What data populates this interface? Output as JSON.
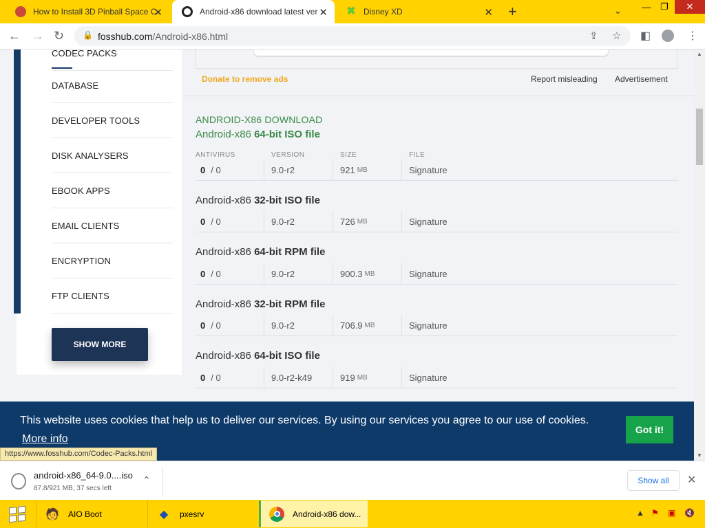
{
  "browser": {
    "tabs": [
      {
        "title": "How to Install 3D Pinball Space C",
        "icon": "pinball-favicon"
      },
      {
        "title": "Android-x86 download latest ver",
        "icon": "fosshub-favicon",
        "active": true
      },
      {
        "title": "Disney XD",
        "icon": "disney-favicon"
      }
    ],
    "url_host": "fosshub.com",
    "url_path": "/Android-x86.html"
  },
  "sidebar": {
    "items": [
      {
        "label": "CODEC PACKS"
      },
      {
        "label": "DATABASE"
      },
      {
        "label": "DEVELOPER TOOLS"
      },
      {
        "label": "DISK ANALYSERS"
      },
      {
        "label": "EBOOK APPS"
      },
      {
        "label": "EMAIL CLIENTS"
      },
      {
        "label": "ENCRYPTION"
      },
      {
        "label": "FTP CLIENTS"
      }
    ],
    "show_more": "SHOW MORE"
  },
  "ad": {
    "donate": "Donate to remove ads",
    "report": "Report misleading",
    "label": "Advertisement"
  },
  "downloads": {
    "header": "ANDROID-X86 DOWNLOAD",
    "columns": [
      "ANTIVIRUS",
      "VERSION",
      "SIZE",
      "FILE"
    ],
    "files": [
      {
        "name": "Android-x86",
        "bold": "64-bit ISO file",
        "av_pos": "0",
        "av_total": "/ 0",
        "version": "9.0-r2",
        "size": "921",
        "unit": "MB",
        "file": "Signature"
      },
      {
        "name": "Android-x86",
        "bold": "32-bit ISO file",
        "av_pos": "0",
        "av_total": "/ 0",
        "version": "9.0-r2",
        "size": "726",
        "unit": "MB",
        "file": "Signature"
      },
      {
        "name": "Android-x86",
        "bold": "64-bit RPM file",
        "av_pos": "0",
        "av_total": "/ 0",
        "version": "9.0-r2",
        "size": "900.3",
        "unit": "MB",
        "file": "Signature"
      },
      {
        "name": "Android-x86",
        "bold": "32-bit RPM file",
        "av_pos": "0",
        "av_total": "/ 0",
        "version": "9.0-r2",
        "size": "706.9",
        "unit": "MB",
        "file": "Signature"
      },
      {
        "name": "Android-x86",
        "bold": "64-bit ISO file",
        "av_pos": "0",
        "av_total": "/ 0",
        "version": "9.0-r2-k49",
        "size": "919",
        "unit": "MB",
        "file": "Signature"
      }
    ]
  },
  "cookie": {
    "text": "This website uses cookies that help us to deliver our services. By using our services you agree to our use of cookies.",
    "more": "More info",
    "button": "Got it!"
  },
  "status_url": "https://www.fosshub.com/Codec-Packs.html",
  "download_shelf": {
    "filename": "android-x86_64-9.0....iso",
    "progress": "87.8/921 MB, 37 secs left",
    "show_all": "Show all"
  },
  "taskbar": {
    "items": [
      {
        "label": "AIO Boot"
      },
      {
        "label": "pxesrv"
      },
      {
        "label": "Android-x86 dow..."
      }
    ]
  }
}
